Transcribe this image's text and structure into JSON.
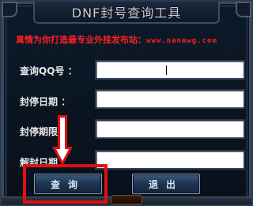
{
  "window": {
    "title": "DNF封号查询工具"
  },
  "banner": {
    "text": "真情为你打造最专业外挂发布站：",
    "url": "www.nanawg.com"
  },
  "fields": [
    {
      "label": "查询QQ号 ：",
      "value": ""
    },
    {
      "label": "封停日期  ：",
      "value": ""
    },
    {
      "label": "封停期限",
      "value": ""
    },
    {
      "label": "解封日期",
      "value": ""
    }
  ],
  "buttons": {
    "query_label": "查询",
    "exit_label": "退出"
  },
  "annotation": {
    "color": "#e01010"
  }
}
